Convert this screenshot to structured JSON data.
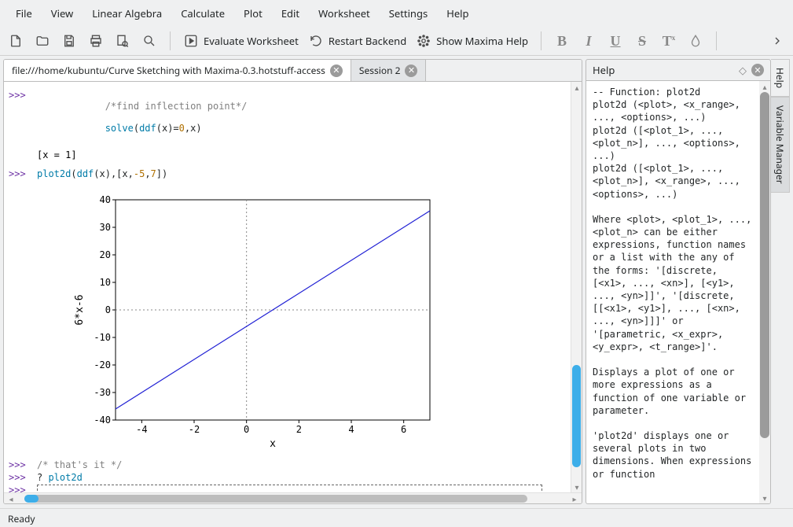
{
  "menu": [
    "File",
    "View",
    "Linear Algebra",
    "Calculate",
    "Plot",
    "Edit",
    "Worksheet",
    "Settings",
    "Help"
  ],
  "toolbar": {
    "evaluate": "Evaluate Worksheet",
    "restart": "Restart Backend",
    "maxima_help": "Show Maxima Help"
  },
  "tabs": [
    {
      "label": "file:///home/kubuntu/Curve Sketching with Maxima-0.3.hotstuff-access",
      "active": true
    },
    {
      "label": "Session 2",
      "active": false
    }
  ],
  "cells": {
    "c1_comment": "/*find inflection point*/",
    "c1_code_html": "<span class='fn'>solve</span>(<span class='fn'>ddf</span>(x)=<span class='num'>0</span>,x)",
    "c1_out": "[x = 1]",
    "c2_code_html": "<span class='fn'>plot2d</span>(<span class='fn'>ddf</span>(x),[x,<span class='num'>-5</span>,<span class='num'>7</span>])",
    "c3_comment": "/* that's it */",
    "c4_code_html": "? <span class='fn'>plot2d</span>"
  },
  "prompts": {
    "in": ">>>"
  },
  "chart_data": {
    "type": "line",
    "x": [
      -5,
      7
    ],
    "y": [
      -36,
      36
    ],
    "xlabel": "x",
    "ylabel": "6*x-6",
    "xticks": [
      -4,
      -2,
      0,
      2,
      4,
      6
    ],
    "yticks": [
      -40,
      -30,
      -20,
      -10,
      0,
      10,
      20,
      30,
      40
    ],
    "xlim": [
      -5,
      7
    ],
    "ylim": [
      -40,
      40
    ],
    "grid_dashed_zero": true
  },
  "help": {
    "title": "Help",
    "body": "-- Function: plot2d\nplot2d (<plot>, <x_range>, ..., <options>, ...)\nplot2d ([<plot_1>, ..., <plot_n>], ..., <options>, ...)\nplot2d ([<plot_1>, ..., <plot_n>], <x_range>, ..., <options>, ...)\n\nWhere <plot>, <plot_1>, ..., <plot_n> can be either expressions, function names or a list with the any of the forms: '[discrete, [<x1>, ..., <xn>], [<y1>, ..., <yn>]]', '[discrete, [[<x1>, <y1>], ..., [<xn>, ..., <yn>]]]' or '[parametric, <x_expr>, <y_expr>, <t_range>]'.\n\nDisplays a plot of one or more expressions as a function of one variable or parameter.\n\n'plot2d' displays one or several plots in two dimensions. When expressions or function"
  },
  "side_tabs": [
    "Help",
    "Variable Manager"
  ],
  "status": "Ready"
}
